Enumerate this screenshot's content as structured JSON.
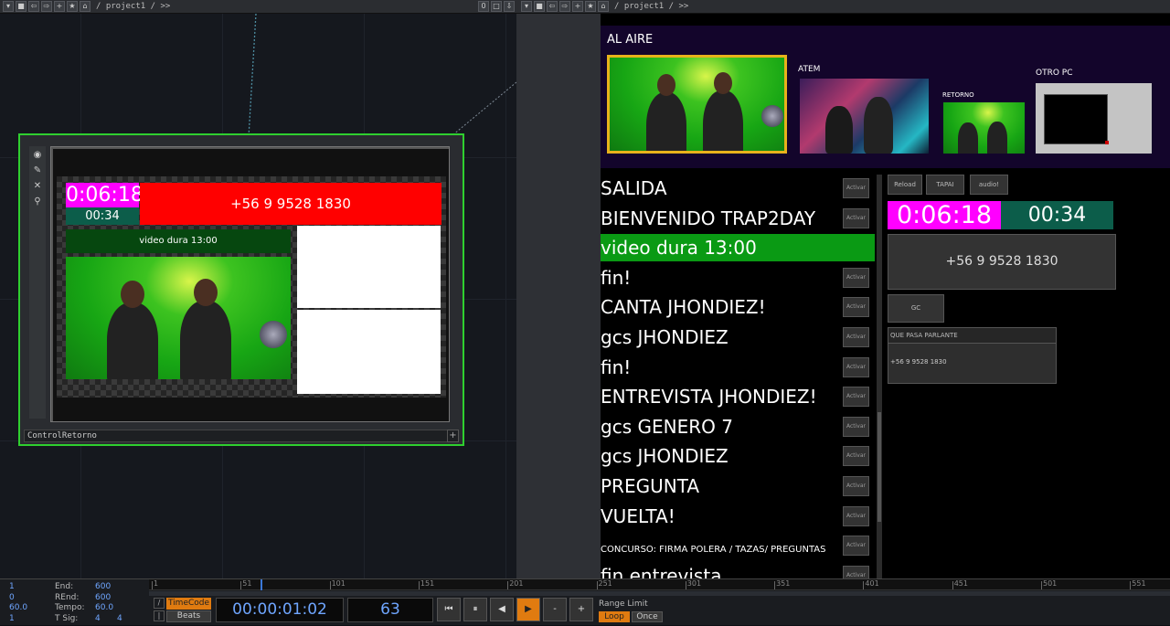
{
  "left_toolbar": {
    "path": "/ project1 / >>",
    "counter": "0"
  },
  "right_toolbar": {
    "path": "/ project1 / >>"
  },
  "node": {
    "label": "ControlRetorno",
    "timer_main": "0:06:18",
    "timer_sub": "00:34",
    "phone_banner": "+56 9 9528 1830",
    "message": "video dura 13:00"
  },
  "panel": {
    "header_title": "AL AIRE",
    "sources": [
      "ATEM",
      "RETORNO",
      "OTRO PC"
    ],
    "cues": [
      {
        "label": "SALIDA",
        "active": false
      },
      {
        "label": "BIENVENIDO TRAP2DAY",
        "active": false
      },
      {
        "label": "video dura 13:00",
        "active": true
      },
      {
        "label": "fin!",
        "active": false
      },
      {
        "label": "CANTA JHONDIEZ!",
        "active": false
      },
      {
        "label": "gcs JHONDIEZ",
        "active": false
      },
      {
        "label": "fin!",
        "active": false
      },
      {
        "label": "ENTREVISTA JHONDIEZ!",
        "active": false
      },
      {
        "label": "gcs GENERO 7",
        "active": false
      },
      {
        "label": "gcs JHONDIEZ",
        "active": false
      },
      {
        "label": "PREGUNTA",
        "active": false
      },
      {
        "label": "VUELTA!",
        "active": false
      },
      {
        "label": "CONCURSO: FIRMA POLERA / TAZAS/ PREGUNTAS",
        "active": false
      },
      {
        "label": "fin entrevista",
        "active": false
      }
    ],
    "activar_label": "Activar",
    "buttons": {
      "reload": "Reload",
      "tapai": "TAPAI",
      "audio": "audio!",
      "gc": "GC"
    },
    "timer_main": "0:06:18",
    "timer_sub": "00:34",
    "phone_display": "+56 9 9528 1830",
    "field_title": "QUE PASA PARLANTE",
    "field_value": "+56 9 9528 1830"
  },
  "timeline": {
    "info_left": [
      "1",
      "0",
      "60.0",
      "1"
    ],
    "info_labels": [
      "End:",
      "REnd:",
      "Tempo:",
      "T Sig:"
    ],
    "info_values": [
      "600",
      "600",
      "60.0",
      "4"
    ],
    "tsig_den": "4",
    "ticks": [
      "1",
      "51",
      "101",
      "151",
      "201",
      "251",
      "301",
      "351",
      "401",
      "451",
      "501",
      "551"
    ],
    "timecode_label": "TimeCode",
    "beats_label": "Beats",
    "timecode": "00:00:01:02",
    "frame": "63",
    "range_limit": "Range Limit",
    "loop": "Loop",
    "once": "Once"
  }
}
